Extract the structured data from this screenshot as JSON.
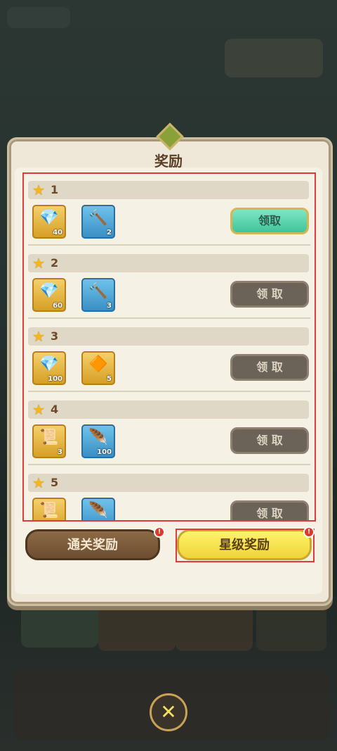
{
  "panel": {
    "title": "奖励"
  },
  "tiers": [
    {
      "stars": "1",
      "items": [
        {
          "icon": "crystal-ore-icon",
          "qty": "40"
        },
        {
          "icon": "hammer-icon",
          "qty": "2"
        }
      ],
      "claim_label": "领取",
      "claimable": true
    },
    {
      "stars": "2",
      "items": [
        {
          "icon": "crystal-ore-icon",
          "qty": "60"
        },
        {
          "icon": "hammer-icon",
          "qty": "3"
        }
      ],
      "claim_label": "领 取",
      "claimable": false
    },
    {
      "stars": "3",
      "items": [
        {
          "icon": "crystal-ore-icon",
          "qty": "100"
        },
        {
          "icon": "amber-crystal-icon",
          "qty": "5"
        }
      ],
      "claim_label": "领 取",
      "claimable": false
    },
    {
      "stars": "4",
      "items": [
        {
          "icon": "scroll-icon",
          "qty": "3"
        },
        {
          "icon": "feather-icon",
          "qty": "100"
        }
      ],
      "claim_label": "领 取",
      "claimable": false
    },
    {
      "stars": "5",
      "items": [
        {
          "icon": "scroll-icon",
          "qty": ""
        },
        {
          "icon": "feather-icon",
          "qty": ""
        }
      ],
      "claim_label": "领 取",
      "claimable": false
    }
  ],
  "tabs": {
    "clear_reward": "通关奖励",
    "star_reward": "星级奖励"
  },
  "colors": {
    "accent_active": "#3fc49a",
    "tab_selected": "#f0d43a",
    "highlight": "#e23a3a"
  }
}
